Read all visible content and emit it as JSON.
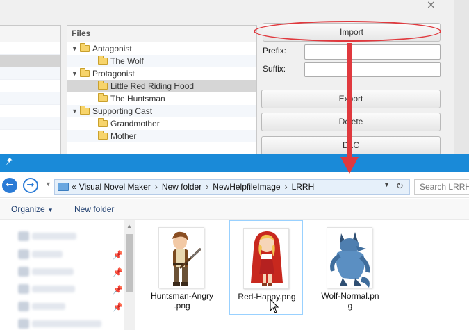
{
  "app": {
    "files_header": "Files",
    "tree": [
      {
        "label": "Antagonist",
        "level": 0,
        "expanded": true
      },
      {
        "label": "The Wolf",
        "level": 1
      },
      {
        "label": "Protagonist",
        "level": 0,
        "expanded": true
      },
      {
        "label": "Little Red Riding Hood",
        "level": 1,
        "selected": true
      },
      {
        "label": "The Huntsman",
        "level": 1
      },
      {
        "label": "Supporting Cast",
        "level": 0,
        "expanded": true
      },
      {
        "label": "Grandmother",
        "level": 1
      },
      {
        "label": "Mother",
        "level": 1
      }
    ],
    "buttons": {
      "import": "Import",
      "export": "Export",
      "delete": "Delete",
      "dlc": "DLC"
    },
    "fields": {
      "prefix_label": "Prefix:",
      "prefix_value": "",
      "suffix_label": "Suffix:",
      "suffix_value": ""
    },
    "close_glyph": "×"
  },
  "explorer": {
    "breadcrumb": [
      "«",
      "Visual Novel Maker",
      "New folder",
      "NewHelpfileImage",
      "LRRH"
    ],
    "search_placeholder": "Search LRRH",
    "commands": {
      "organize": "Organize",
      "new_folder": "New folder"
    },
    "files": [
      {
        "line1": "Huntsman-Angry",
        "line2": ".png",
        "selected": false
      },
      {
        "line1": "Red-Happy.png",
        "line2": "",
        "selected": true
      },
      {
        "line1": "Wolf-Normal.pn",
        "line2": "g",
        "selected": false
      }
    ]
  },
  "colors": {
    "titlebar_blue": "#1a8ad8",
    "annotation_red": "#e0393e",
    "selection_border": "#99d1ff"
  }
}
